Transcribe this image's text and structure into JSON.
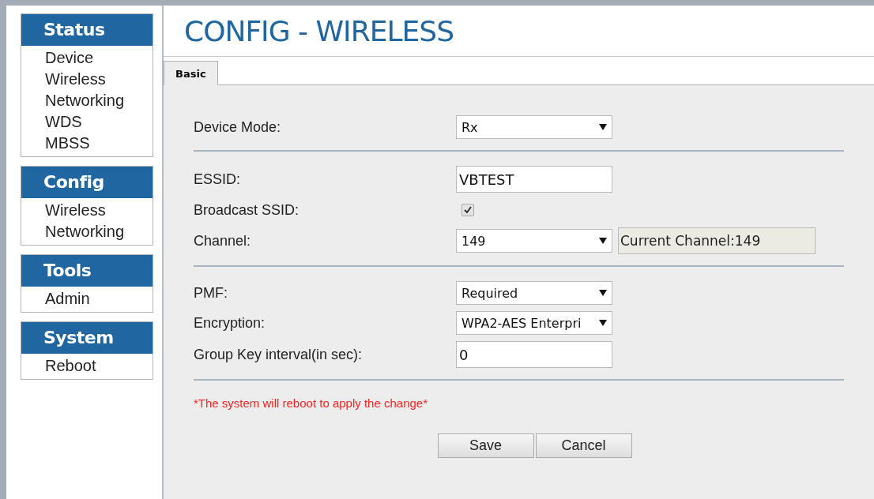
{
  "sidebar": {
    "groups": [
      {
        "title": "Status",
        "items": [
          {
            "label": "Device"
          },
          {
            "label": "Wireless"
          },
          {
            "label": "Networking"
          },
          {
            "label": "WDS"
          },
          {
            "label": "MBSS"
          }
        ]
      },
      {
        "title": "Config",
        "items": [
          {
            "label": "Wireless"
          },
          {
            "label": "Networking"
          }
        ]
      },
      {
        "title": "Tools",
        "items": [
          {
            "label": "Admin"
          }
        ]
      },
      {
        "title": "System",
        "items": [
          {
            "label": "Reboot"
          }
        ]
      }
    ]
  },
  "page_title": "CONFIG - WIRELESS",
  "tabs": [
    {
      "label": "Basic",
      "selected": true
    }
  ],
  "sections": [
    {
      "rows": [
        {
          "kind": "select",
          "label": "Device Mode:",
          "value": "Rx"
        }
      ]
    },
    {
      "rows": [
        {
          "kind": "text",
          "label": "ESSID:",
          "value": "VBTEST"
        },
        {
          "kind": "checkbox",
          "label": "Broadcast SSID:",
          "checked": true
        },
        {
          "kind": "select",
          "label": "Channel:",
          "value": "149",
          "info": "Current Channel:149"
        }
      ]
    },
    {
      "rows": [
        {
          "kind": "select",
          "label": "PMF:",
          "value": "Required"
        },
        {
          "kind": "select",
          "label": "Encryption:",
          "value": "WPA2-AES Enterpri"
        },
        {
          "kind": "text",
          "label": "Group Key interval(in sec):",
          "value": "0"
        }
      ]
    }
  ],
  "warning": "*The system will reboot to apply the change*",
  "buttons": [
    "Save",
    "Cancel"
  ]
}
